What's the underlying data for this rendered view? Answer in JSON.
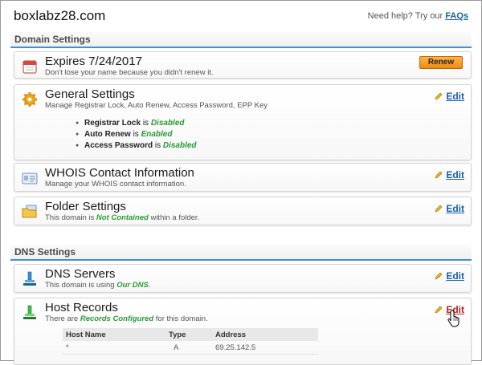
{
  "header": {
    "domain": "boxlabz28.com",
    "help_prefix": "Need help? Try our ",
    "help_link": "FAQs"
  },
  "sections": {
    "domain_settings": "Domain Settings",
    "dns_settings": "DNS Settings"
  },
  "expires": {
    "title": "Expires 7/24/2017",
    "desc": "Don't lose your name because you didn't renew it.",
    "button": "Renew",
    "icon": "calendar-icon"
  },
  "general": {
    "title": "General Settings",
    "desc": "Manage Registrar Lock, Auto Renew, Access Password, EPP Key",
    "edit": "Edit",
    "icon": "gear-icon",
    "items": [
      {
        "label": "Registrar Lock",
        "is": " is ",
        "value": "Disabled"
      },
      {
        "label": "Auto Renew",
        "is": " is ",
        "value": "Enabled"
      },
      {
        "label": "Access Password",
        "is": " is ",
        "value": "Disabled"
      }
    ]
  },
  "whois": {
    "title": "WHOIS Contact Information",
    "desc": "Manage your WHOIS contact information.",
    "edit": "Edit",
    "icon": "contact-card-icon"
  },
  "folder": {
    "title": "Folder Settings",
    "desc_pre": "This domain is ",
    "desc_em": "Not Contained",
    "desc_post": " within a folder.",
    "edit": "Edit",
    "icon": "folder-icon"
  },
  "dns_servers": {
    "title": "DNS Servers",
    "desc_pre": "This domain is using ",
    "desc_em": "Our DNS",
    "desc_post": ".",
    "edit": "Edit",
    "icon": "server-icon"
  },
  "host_records": {
    "title": "Host Records",
    "desc_pre": "There are ",
    "desc_em": "Records Configured",
    "desc_post": " for this domain.",
    "edit": "Edit",
    "icon": "host-records-icon",
    "columns": [
      "Host Name",
      "Type",
      "Address"
    ],
    "rows": [
      {
        "host": "*",
        "type": "A",
        "address": "69.25.142.5"
      }
    ]
  },
  "colors": {
    "link": "#1a5fa8",
    "accent_line": "#3f90d6",
    "enabled_green": "#2a9a35",
    "renew_orange": "#f08a10",
    "edit_hover": "#b3261e"
  }
}
